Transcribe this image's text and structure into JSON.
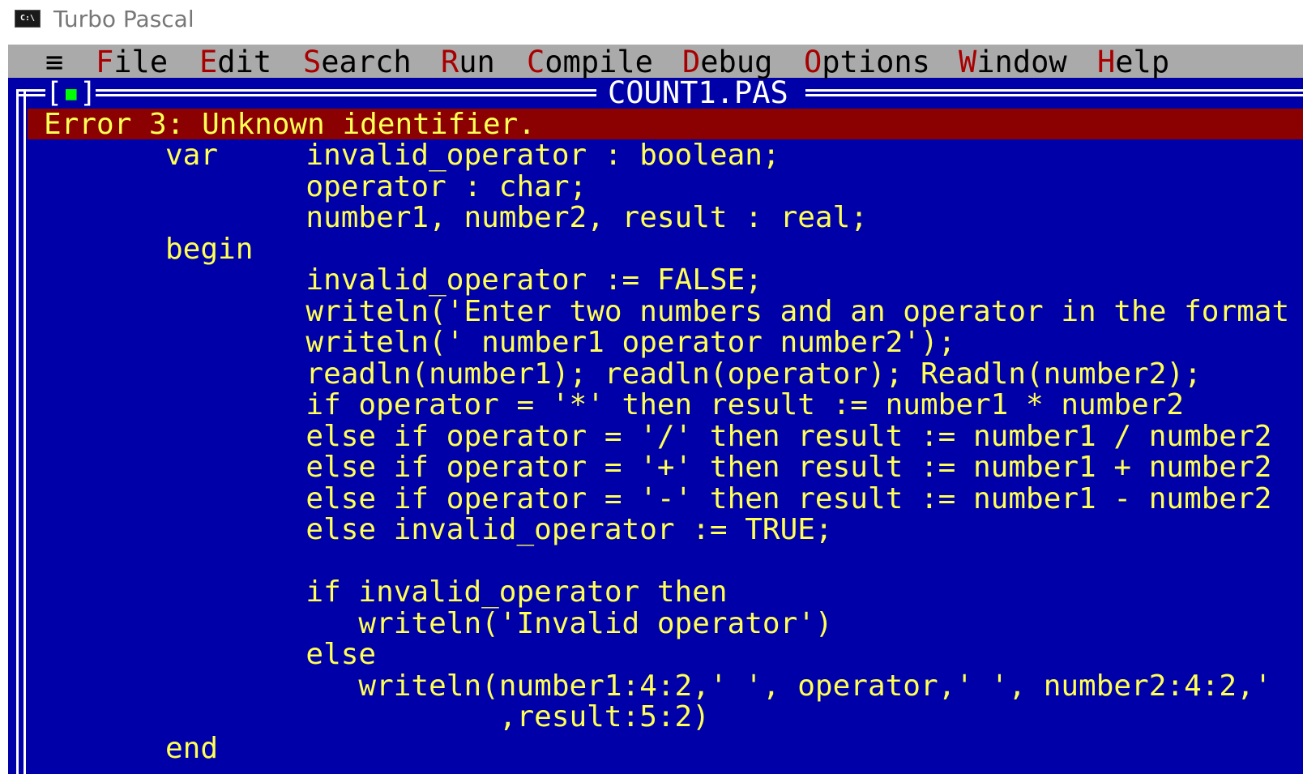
{
  "window": {
    "icon_label": "C:\\",
    "title": "Turbo Pascal"
  },
  "menu": {
    "system_glyph": "≡",
    "items": [
      {
        "hotkey": "F",
        "rest": "ile"
      },
      {
        "hotkey": "E",
        "rest": "dit"
      },
      {
        "hotkey": "S",
        "rest": "earch"
      },
      {
        "hotkey": "R",
        "rest": "un"
      },
      {
        "hotkey": "C",
        "rest": "ompile"
      },
      {
        "hotkey": "D",
        "rest": "ebug"
      },
      {
        "hotkey": "O",
        "rest": "ptions"
      },
      {
        "hotkey": "W",
        "rest": "indow"
      },
      {
        "hotkey": "H",
        "rest": "elp"
      }
    ]
  },
  "editor": {
    "close_box_open": "[",
    "close_box_mark": "▪",
    "close_box_close": "]",
    "filename": "COUNT1.PAS",
    "error_message": "Error 3: Unknown identifier.",
    "lines": [
      "var     invalid_operator : boolean;",
      "        operator : char;",
      "        number1, number2, result : real;",
      "begin",
      "        invalid_operator := FALSE;",
      "        writeln('Enter two numbers and an operator in the format",
      "        writeln(' number1 operator number2');",
      "        readln(number1); readln(operator); Readln(number2);",
      "        if operator = '*' then result := number1 * number2",
      "        else if operator = '/' then result := number1 / number2",
      "        else if operator = '+' then result := number1 + number2",
      "        else if operator = '-' then result := number1 - number2",
      "        else invalid_operator := TRUE;",
      "",
      "        if invalid_operator then",
      "           writeln('Invalid operator')",
      "        else",
      "           writeln(number1:4:2,' ', operator,' ', number2:4:2,'",
      "                   ,result:5:2)",
      "end"
    ]
  },
  "colors": {
    "console_bg": "#0000a8",
    "menu_bg": "#aaaaaa",
    "menu_hotkey": "#a80000",
    "code_text": "#ffff55",
    "error_bg": "#8b0000",
    "frame": "#ffffff"
  }
}
